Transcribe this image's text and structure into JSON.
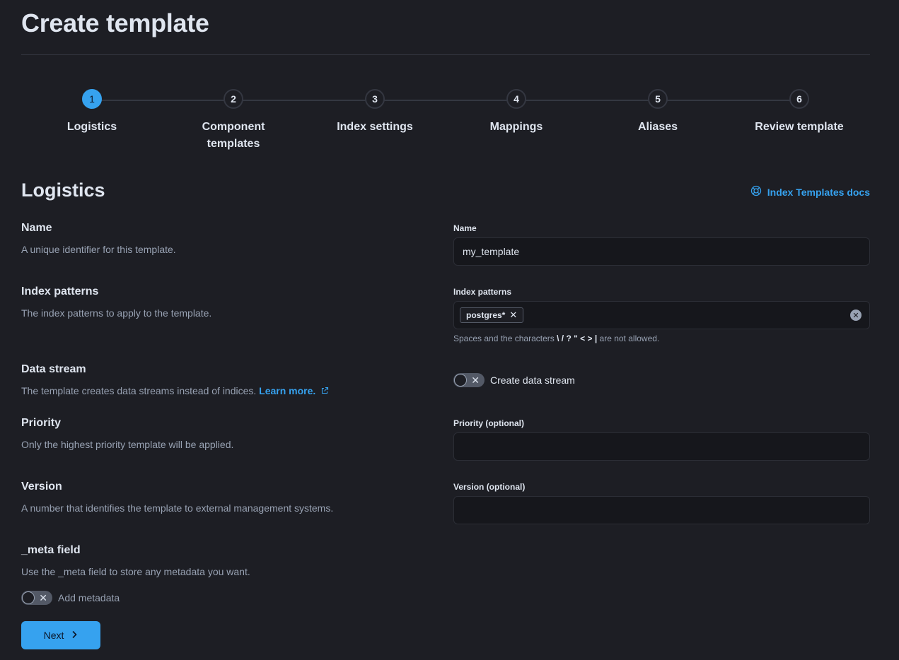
{
  "page": {
    "title": "Create template"
  },
  "steps": [
    {
      "number": "1",
      "label": "Logistics"
    },
    {
      "number": "2",
      "label": "Component templates"
    },
    {
      "number": "3",
      "label": "Index settings"
    },
    {
      "number": "4",
      "label": "Mappings"
    },
    {
      "number": "5",
      "label": "Aliases"
    },
    {
      "number": "6",
      "label": "Review template"
    }
  ],
  "section": {
    "title": "Logistics",
    "docs_link": "Index Templates docs"
  },
  "name": {
    "title": "Name",
    "description": "A unique identifier for this template.",
    "field_label": "Name",
    "value": "my_template"
  },
  "index_patterns": {
    "title": "Index patterns",
    "description": "The index patterns to apply to the template.",
    "field_label": "Index patterns",
    "pill": "postgres*",
    "help_prefix": "Spaces and the characters",
    "help_chars": "\\ / ? \" < > |",
    "help_suffix": "are not allowed."
  },
  "data_stream": {
    "title": "Data stream",
    "description": "The template creates data streams instead of indices.",
    "learn_more": "Learn more.",
    "switch_label": "Create data stream"
  },
  "priority": {
    "title": "Priority",
    "description": "Only the highest priority template will be applied.",
    "field_label": "Priority (optional)",
    "value": ""
  },
  "version": {
    "title": "Version",
    "description": "A number that identifies the template to external management systems.",
    "field_label": "Version (optional)",
    "value": ""
  },
  "meta": {
    "title": "_meta field",
    "description": "Use the _meta field to store any metadata you want.",
    "switch_label": "Add metadata"
  },
  "footer": {
    "next_label": "Next"
  },
  "colors": {
    "accent": "#36a2ef",
    "background": "#1d1e24",
    "field": "#16171c"
  }
}
